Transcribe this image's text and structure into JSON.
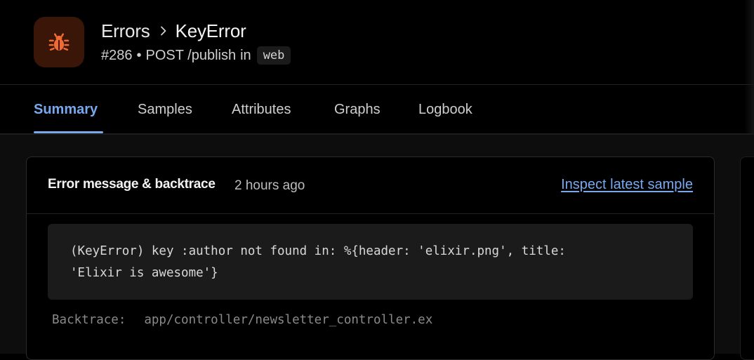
{
  "header": {
    "breadcrumb": {
      "parent": "Errors",
      "current": "KeyError"
    },
    "subtitle": {
      "incident": "#286",
      "separator": "•",
      "action": "POST /publish",
      "in_word": "in",
      "namespace": "web"
    },
    "icon": "bug-icon"
  },
  "tabs": [
    {
      "label": "Summary",
      "active": true
    },
    {
      "label": "Samples",
      "active": false
    },
    {
      "label": "Attributes",
      "active": false
    },
    {
      "label": "Graphs",
      "active": false
    },
    {
      "label": "Logbook",
      "active": false
    }
  ],
  "card": {
    "title": "Error message & backtrace",
    "time": "2 hours ago",
    "link": "Inspect latest sample",
    "message": "(KeyError) key :author not found in: %{header: 'elixir.png', title:\n'Elixir is awesome'}",
    "backtrace_label": "Backtrace:",
    "backtrace_path": "app/controller/newsletter_controller.ex"
  },
  "colors": {
    "accent": "#78a9ef",
    "icon_bg": "#3a1608",
    "icon_fg": "#f06a32"
  }
}
